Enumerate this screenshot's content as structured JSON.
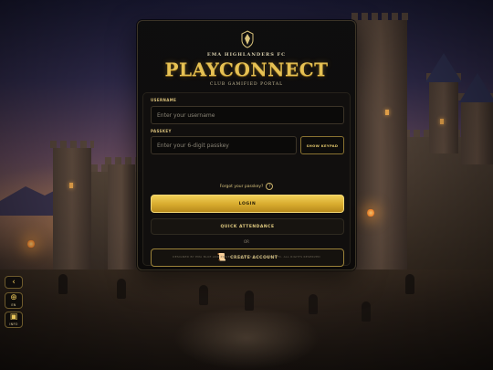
{
  "scene": {
    "description_icon": "medieval-castle-backdrop"
  },
  "side_rail": {
    "back_icon": "chevron-left-icon",
    "items": [
      {
        "icon": "compass-icon",
        "label": "EN"
      },
      {
        "icon": "badge-icon",
        "label": "INFO"
      }
    ]
  },
  "card": {
    "crest_icon": "crest-icon",
    "club_name": "EMA HIGHLANDERS FC",
    "brand": "PLAYCONNECT",
    "subtitle": "CLUB GAMIFIED PORTAL"
  },
  "form": {
    "username_label": "USERNAME",
    "username_placeholder": "Enter your username",
    "passkey_label": "PASSKEY",
    "passkey_placeholder": "Enter your 6-digit passkey",
    "show_keypad_label": "SHOW KEYPAD",
    "forgot_label": "Forgot your passkey?",
    "login_label": "LOGIN",
    "quick_attendance_label": "QUICK ATTENDANCE",
    "or_label": "OR",
    "create_account_label": "CREATE ACCOUNT",
    "create_account_icon": "scroll-icon"
  },
  "footer": {
    "text": "DESIGNED BY EMA BLUE AND POWERED AND THE HIGHLANDERS FC. ALL RIGHTS RESERVED"
  },
  "colors": {
    "accent_gold": "#e6c153",
    "login_button": "#d7aa2d",
    "card_bg": "#0e0d0c"
  }
}
